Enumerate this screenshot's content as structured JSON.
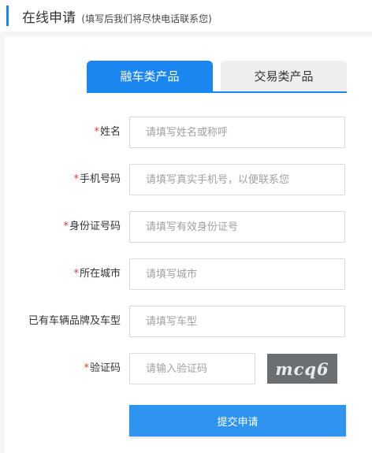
{
  "header": {
    "title": "在线申请",
    "subtitle": "(填写后我们将尽快电话联系您)"
  },
  "tabs": [
    {
      "label": "融车类产品",
      "active": true
    },
    {
      "label": "交易类产品",
      "active": false
    }
  ],
  "form": {
    "name": {
      "label": "姓名",
      "required": true,
      "placeholder": "请填写姓名或称呼"
    },
    "phone": {
      "label": "手机号码",
      "required": true,
      "placeholder": "请填写真实手机号，以便联系您"
    },
    "id_number": {
      "label": "身份证号码",
      "required": true,
      "placeholder": "请填写有效身份证号"
    },
    "city": {
      "label": "所在城市",
      "required": true,
      "placeholder": "请填写城市"
    },
    "car_model": {
      "label": "已有车辆品牌及车型",
      "required": false,
      "placeholder": "请填写车型"
    },
    "captcha": {
      "label": "验证码",
      "required": true,
      "placeholder": "请输入验证码",
      "image_text": "mcq6"
    },
    "required_mark": "*",
    "submit_label": "提交申请"
  },
  "colors": {
    "accent": "#1b86f0",
    "submit": "#2f93f0",
    "required": "#e8382f",
    "captcha_bg": "#6b6f72"
  }
}
